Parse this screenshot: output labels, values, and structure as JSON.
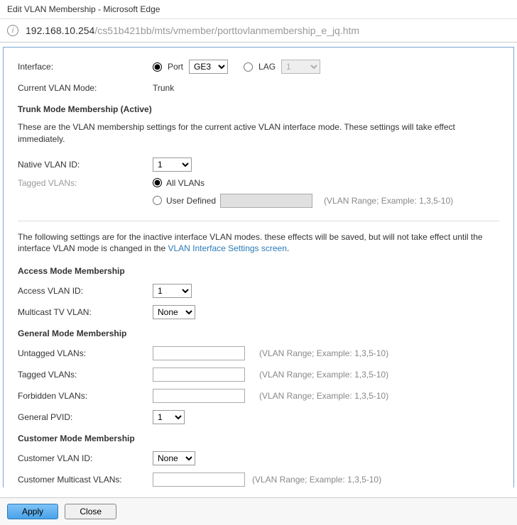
{
  "window": {
    "title": "Edit VLAN Membership - Microsoft Edge"
  },
  "url": {
    "host": "192.168.10.254",
    "path": "/cs51b421bb/mts/vmember/porttovlanmembership_e_jq.htm"
  },
  "interface": {
    "label": "Interface:",
    "port_label": "Port",
    "port_value": "GE3",
    "lag_label": "LAG",
    "lag_value": "1"
  },
  "current_mode": {
    "label": "Current VLAN Mode:",
    "value": "Trunk"
  },
  "trunk": {
    "heading": "Trunk Mode Membership (Active)",
    "desc": "These are the VLAN membership settings for the current active VLAN interface mode. These settings will take effect immediately.",
    "native_label": "Native VLAN ID:",
    "native_value": "1",
    "tagged_label": "Tagged VLANs:",
    "all_label": "All VLANs",
    "userdef_label": "User Defined",
    "userdef_value": "",
    "range_hint": "(VLAN Range; Example: 1,3,5-10)"
  },
  "inactive_note": {
    "text1": "The following settings are for the inactive interface VLAN modes. these effects will be saved, but will not take effect until the interface VLAN mode is changed in the ",
    "link": "VLAN Interface Settings screen",
    "text2": "."
  },
  "access": {
    "heading": "Access Mode Membership",
    "vlan_label": "Access VLAN ID:",
    "vlan_value": "1",
    "tv_label": "Multicast TV VLAN:",
    "tv_value": "None"
  },
  "general": {
    "heading": "General Mode Membership",
    "untagged_label": "Untagged VLANs:",
    "tagged_label": "Tagged VLANs:",
    "forbidden_label": "Forbidden VLANs:",
    "pvid_label": "General PVID:",
    "pvid_value": "1",
    "range_hint": "(VLAN Range; Example: 1,3,5-10)"
  },
  "customer": {
    "heading": "Customer Mode Membership",
    "vlan_label": "Customer VLAN ID:",
    "vlan_value": "None",
    "mcast_label": "Customer Multicast VLANs:",
    "range_hint": "(VLAN Range; Example: 1,3,5-10)"
  },
  "buttons": {
    "apply": "Apply",
    "close": "Close"
  }
}
